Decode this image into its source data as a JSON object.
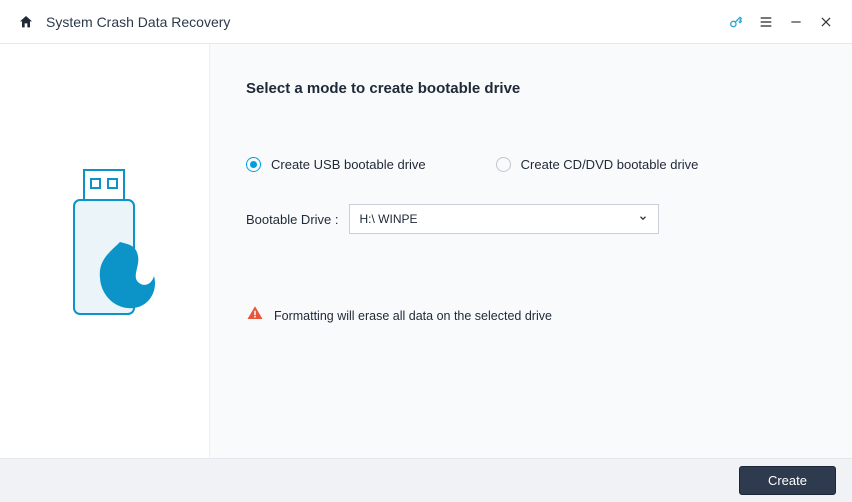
{
  "titlebar": {
    "title": "System Crash Data Recovery"
  },
  "main": {
    "heading": "Select a mode to create bootable drive",
    "option_usb": "Create USB bootable drive",
    "option_cd": "Create CD/DVD bootable drive",
    "selected": "usb",
    "drive_label": "Bootable Drive :",
    "drive_value": "H:\\ WINPE",
    "warning": "Formatting will erase all data on the selected drive"
  },
  "footer": {
    "create": "Create"
  }
}
